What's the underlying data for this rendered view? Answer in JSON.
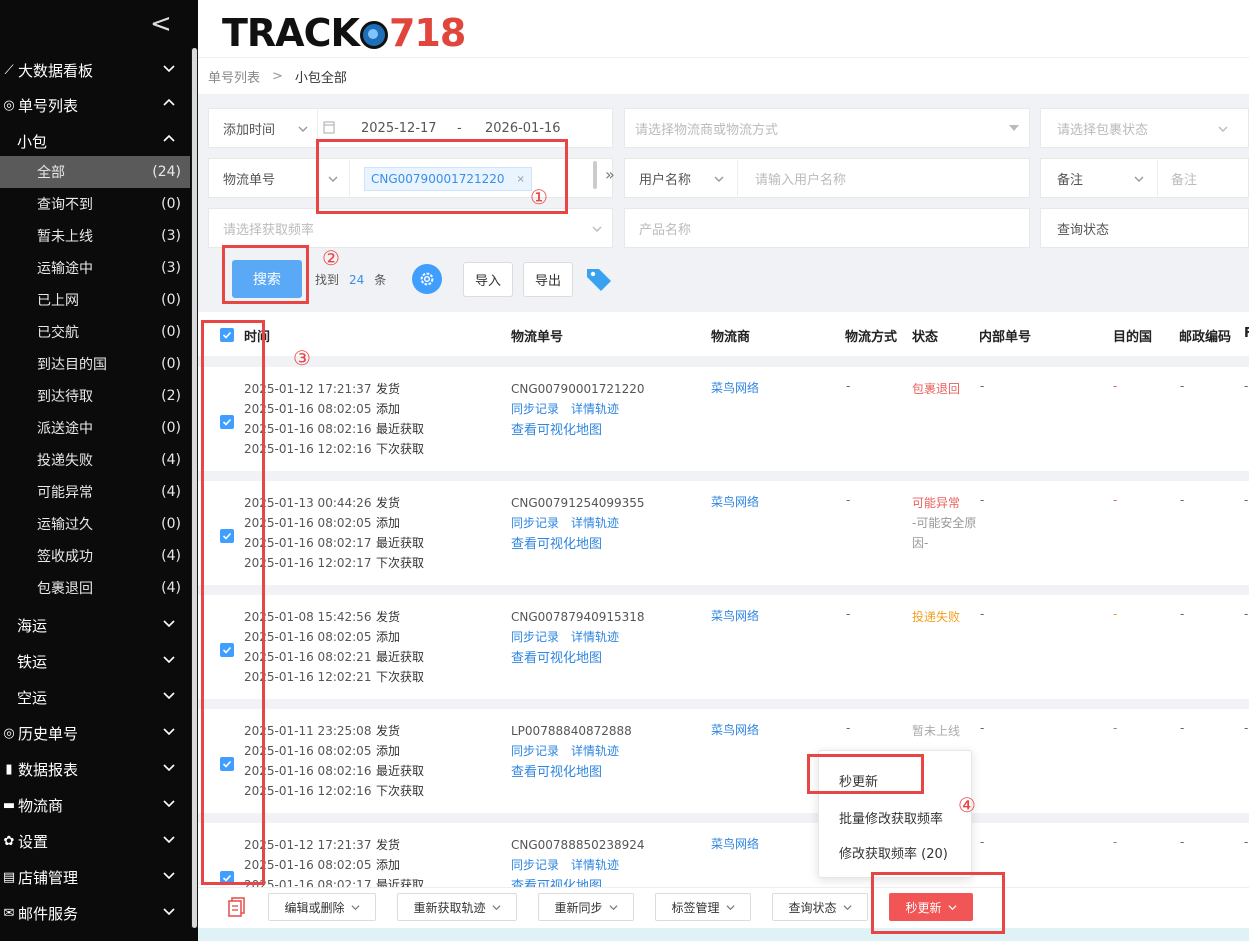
{
  "sidebar": {
    "collapse_glyph": "<",
    "items": [
      {
        "label": "大数据看板",
        "icon": "chart-line-icon",
        "expanded": false
      },
      {
        "label": "单号列表",
        "icon": "target-icon",
        "expanded": true
      },
      {
        "label": "海运",
        "expanded": false
      },
      {
        "label": "铁运",
        "expanded": false
      },
      {
        "label": "空运",
        "expanded": false
      },
      {
        "label": "历史单号",
        "icon": "target-icon",
        "expanded": false
      },
      {
        "label": "数据报表",
        "icon": "bar-chart-icon",
        "expanded": false
      },
      {
        "label": "物流商",
        "icon": "truck-icon",
        "expanded": false
      },
      {
        "label": "设置",
        "icon": "gear-icon",
        "expanded": false
      },
      {
        "label": "店铺管理",
        "icon": "store-icon",
        "expanded": false
      },
      {
        "label": "邮件服务",
        "icon": "mail-icon",
        "expanded": false
      }
    ],
    "group_label": "小包",
    "sub_items": [
      {
        "label": "全部",
        "count": "(24)",
        "active": true
      },
      {
        "label": "查询不到",
        "count": "(0)"
      },
      {
        "label": "暂未上线",
        "count": "(3)"
      },
      {
        "label": "运输途中",
        "count": "(3)"
      },
      {
        "label": "已上网",
        "count": "(0)"
      },
      {
        "label": "已交航",
        "count": "(0)"
      },
      {
        "label": "到达目的国",
        "count": "(0)"
      },
      {
        "label": "到达待取",
        "count": "(2)"
      },
      {
        "label": "派送途中",
        "count": "(0)"
      },
      {
        "label": "投递失败",
        "count": "(4)"
      },
      {
        "label": "可能异常",
        "count": "(4)"
      },
      {
        "label": "运输过久",
        "count": "(0)"
      },
      {
        "label": "签收成功",
        "count": "(4)"
      },
      {
        "label": "包裹退回",
        "count": "(4)"
      }
    ]
  },
  "header": {
    "logo_text": "TRACK",
    "logo_num": "718"
  },
  "breadcrumb": {
    "parent": "单号列表",
    "sep": ">",
    "current": "小包全部"
  },
  "filters": {
    "time_type": "添加时间",
    "date_start": "2025-12-17",
    "date_dash": "-",
    "date_end": "2026-01-16",
    "carrier_placeholder": "请选择物流商或物流方式",
    "pkg_status_placeholder": "请选择包裹状态",
    "tracking_label": "物流单号",
    "tracking_tag": "CNG00790001721220",
    "tag_close": "×",
    "expand_glyph": "»",
    "username_label": "用户名称",
    "username_placeholder": "请输入用户名称",
    "remark_label": "备注",
    "remark_placeholder": "备注",
    "freq_placeholder": "请选择获取频率",
    "product_placeholder": "产品名称",
    "query_status_label": "查询状态",
    "search_button": "搜索",
    "found_prefix": "找到",
    "found_count": "24",
    "found_suffix": "条",
    "import_button": "导入",
    "export_button": "导出"
  },
  "table": {
    "columns": [
      "时间",
      "物流单号",
      "物流商",
      "物流方式",
      "状态",
      "内部单号",
      "目的国",
      "邮政编码",
      "F"
    ],
    "time_labels": [
      "发货",
      "添加",
      "最近获取",
      "下次获取"
    ],
    "sync_link": "同步记录",
    "detail_link": "详情轨迹",
    "map_link": "查看可视化地图",
    "rows": [
      {
        "times": [
          "2025-01-12 17:21:37",
          "2025-01-16 08:02:05",
          "2025-01-16 08:02:16",
          "2025-01-16 12:02:16"
        ],
        "tracking": "CNG00790001721220",
        "carrier": "菜鸟网络",
        "method": "-",
        "status": "包裹退回",
        "status_color": "#e8605c",
        "status_sub": "",
        "inner": "-",
        "dest": "-",
        "dest_color": "#e8605c",
        "post": "-",
        "more": "-"
      },
      {
        "times": [
          "2025-01-13 00:44:26",
          "2025-01-16 08:02:05",
          "2025-01-16 08:02:17",
          "2025-01-16 12:02:17"
        ],
        "tracking": "CNG00791254099355",
        "carrier": "菜鸟网络",
        "method": "-",
        "status": "可能异常",
        "status_color": "#e8605c",
        "status_sub": "-可能安全原因-",
        "inner": "-",
        "dest": "-",
        "dest_color": "#e8605c",
        "post": "-",
        "more": "-"
      },
      {
        "times": [
          "2025-01-08 15:42:56",
          "2025-01-16 08:02:05",
          "2025-01-16 08:02:21",
          "2025-01-16 12:02:21"
        ],
        "tracking": "CNG00787940915318",
        "carrier": "菜鸟网络",
        "method": "-",
        "status": "投递失败",
        "status_color": "#f0a020",
        "status_sub": "",
        "inner": "-",
        "dest": "-",
        "dest_color": "#f0a020",
        "post": "-",
        "more": "-"
      },
      {
        "times": [
          "2025-01-11 23:25:08",
          "2025-01-16 08:02:05",
          "2025-01-16 08:02:16",
          "2025-01-16 12:02:16"
        ],
        "tracking": "LP00788840872888",
        "carrier": "菜鸟网络",
        "method": "-",
        "status": "暂未上线",
        "status_color": "#aaaaaa",
        "status_sub": "",
        "inner": "-",
        "dest": "-",
        "dest_color": "#888888",
        "post": "-",
        "more": "-"
      },
      {
        "times": [
          "2025-01-12 17:21:37",
          "2025-01-16 08:02:05",
          "2025-01-16 08:02:17",
          ""
        ],
        "tracking": "CNG00788850238924",
        "carrier": "菜鸟网络",
        "method": "-",
        "status": "",
        "status_color": "#aaaaaa",
        "status_sub": "",
        "inner": "-",
        "dest": "-",
        "dest_color": "#888888",
        "post": "-",
        "more": "-"
      }
    ]
  },
  "menu": {
    "items": [
      "秒更新",
      "批量修改获取频率",
      "修改获取频率 (20)"
    ]
  },
  "toolbar": {
    "edit_delete": "编辑或删除",
    "refetch": "重新获取轨迹",
    "resync": "重新同步",
    "tag_manage": "标签管理",
    "query_status": "查询状态",
    "second_update": "秒更新"
  },
  "annotations": [
    "①",
    "②",
    "③",
    "④"
  ],
  "colors": {
    "accent": "#409eff",
    "link": "#2f86e0",
    "annotation": "#e84545",
    "danger": "#f25555"
  }
}
